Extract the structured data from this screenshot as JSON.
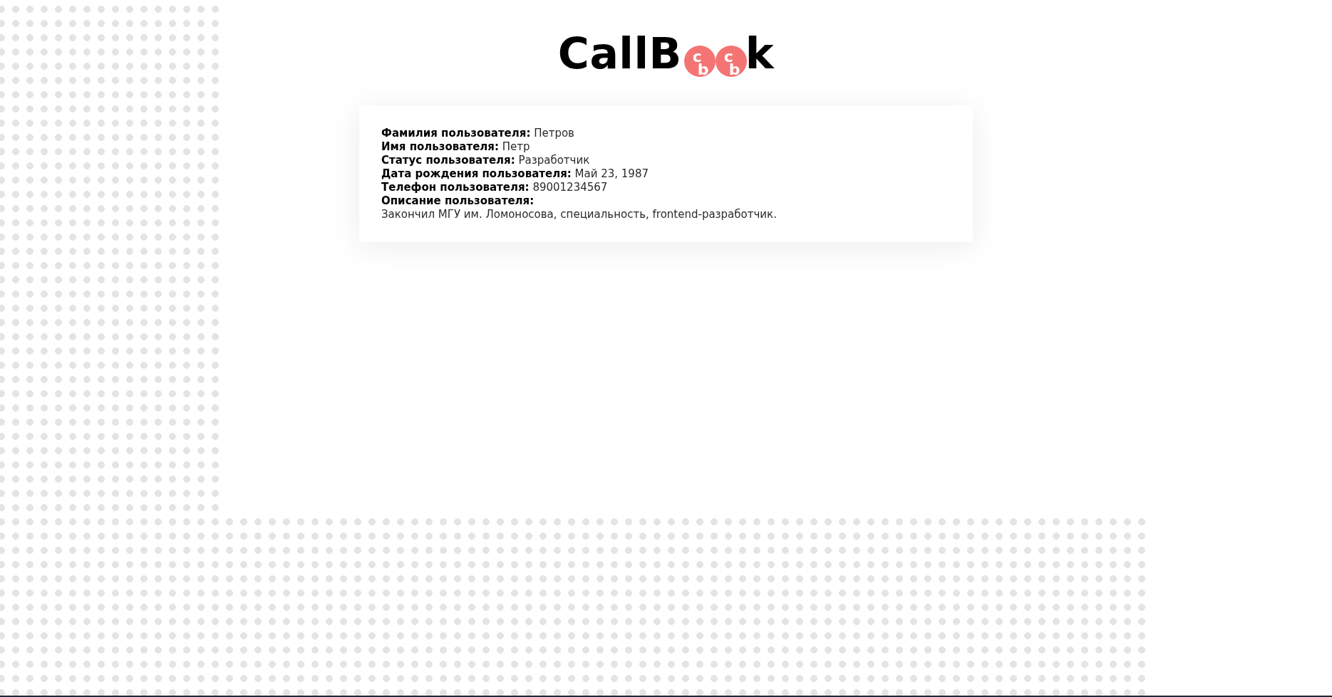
{
  "logo": {
    "parts": [
      {
        "kind": "text",
        "text": "CallB"
      },
      {
        "kind": "badge",
        "text": "cb"
      },
      {
        "kind": "badge",
        "text": "cb"
      },
      {
        "kind": "text",
        "text": "k"
      }
    ]
  },
  "profile": {
    "fields": [
      {
        "label": "Фамилия пользователя:",
        "value": "Петров"
      },
      {
        "label": "Имя пользователя:",
        "value": "Петр"
      },
      {
        "label": "Статус пользователя:",
        "value": "Разработчик"
      },
      {
        "label": "Дата рождения пользователя:",
        "value": "Май 23, 1987"
      },
      {
        "label": "Телефон пользователя:",
        "value": "89001234567"
      }
    ],
    "description": {
      "label": "Описание пользователя:",
      "text": "Закончил МГУ им. Ломоносова, специальность, frontend-разработчик."
    }
  }
}
